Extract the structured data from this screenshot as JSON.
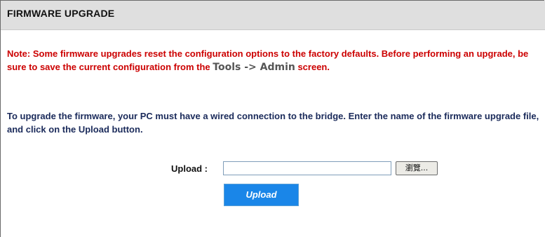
{
  "section": {
    "title": "FIRMWARE UPGRADE"
  },
  "note": {
    "text": "Note: Some firmware upgrades reset the configuration options to the factory defaults. Before performing an upgrade, be sure to save the current configuration from the ",
    "path": "Tools -> Admin",
    "text_end": " screen."
  },
  "info": {
    "text": "To upgrade the firmware, your PC must have a wired connection to the bridge. Enter the name of the firmware upgrade file, and click on the Upload button."
  },
  "form": {
    "upload_label": "Upload :",
    "file_value": "",
    "browse_label": "瀏覽...",
    "upload_button": "Upload"
  },
  "colors": {
    "header_bg": "#dfdfdf",
    "note_text": "#cc0000",
    "info_text": "#1a2a5a",
    "button_bg": "#1a86e8"
  }
}
